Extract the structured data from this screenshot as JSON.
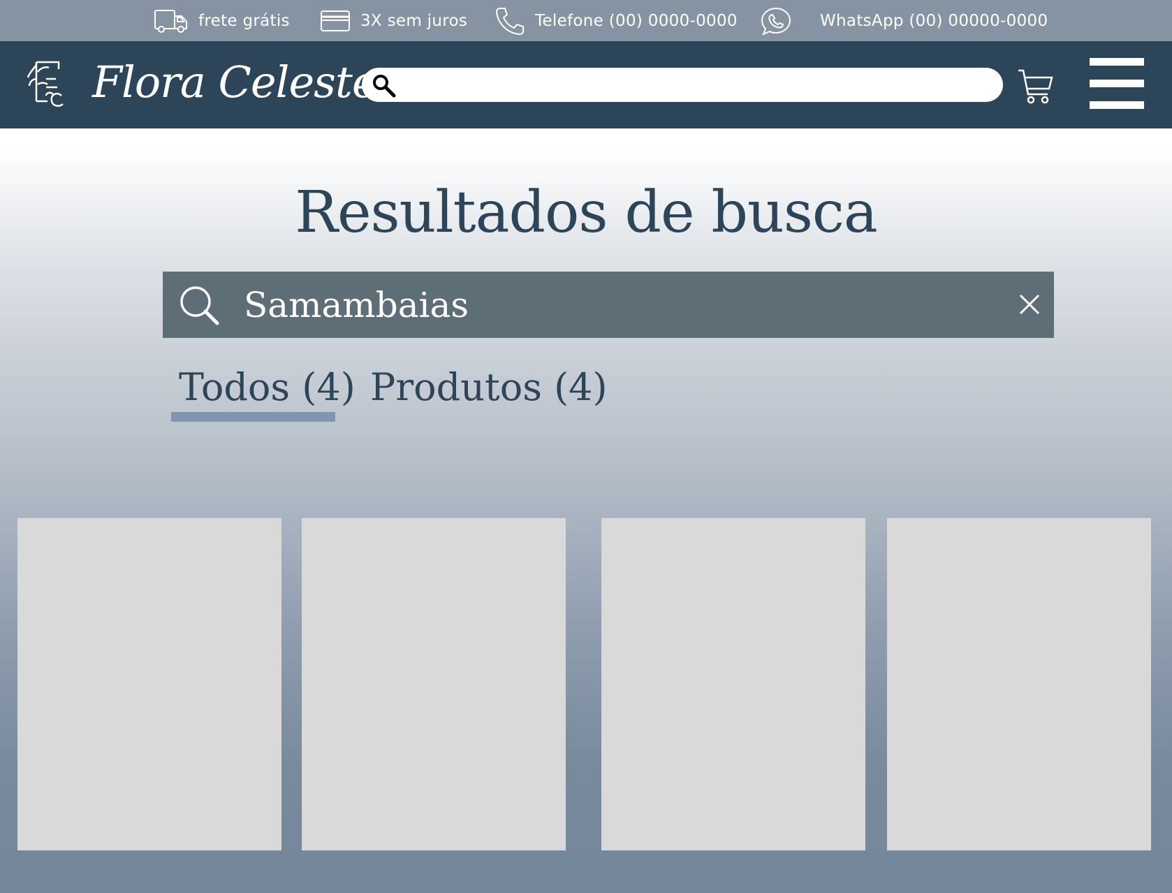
{
  "infobar": {
    "shipping": "frete grátis",
    "installments": "3X sem juros",
    "phone": "Telefone (00) 0000-0000",
    "whatsapp": "WhatsApp (00) 00000-0000"
  },
  "header": {
    "brand": "Flora Celeste",
    "search_value": ""
  },
  "main": {
    "title": "Resultados de busca",
    "search_value": "Samambaias",
    "tabs": [
      {
        "label": "Todos (4)",
        "active": true
      },
      {
        "label": "Produtos (4)",
        "active": false
      }
    ],
    "results_count": 4
  },
  "colors": {
    "infobar_bg": "#8593a3",
    "header_bg": "#2d4558",
    "title_color": "#2d4558",
    "results_search_bg": "#5d6e76",
    "tab_underline": "#8095af",
    "card_placeholder": "#d9d9d9"
  },
  "icons": {
    "shipping": "truck-icon",
    "installments": "credit-card-icon",
    "phone": "phone-icon",
    "whatsapp": "whatsapp-icon",
    "header_search": "search-icon",
    "cart": "cart-icon",
    "menu": "hamburger-menu-icon",
    "results_search": "search-icon",
    "clear": "close-icon"
  }
}
